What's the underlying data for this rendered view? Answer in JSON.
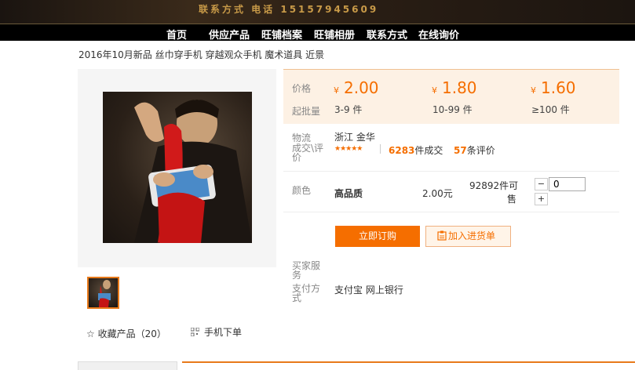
{
  "banner": {
    "contact": "联系方式 电话 15157945609"
  },
  "nav": [
    "首页",
    "供应产品",
    "旺铺档案",
    "旺铺相册",
    "联系方式",
    "在线询价"
  ],
  "product": {
    "title": "2016年10月新品 丝巾穿手机 穿越观众手机 魔术道具 近景",
    "favorite": "☆ 收藏产品（20）",
    "mobile_order": "手机下单"
  },
  "pricing": {
    "price_label": "价格",
    "moq_label": "起批量",
    "currency": "¥",
    "tiers": [
      {
        "price": "2.00",
        "qty": "3-9 件"
      },
      {
        "price": "1.80",
        "qty": "10-99 件"
      },
      {
        "price": "1.60",
        "qty": "≥100 件"
      }
    ]
  },
  "logistics": {
    "label": "物流",
    "origin": "浙江 金华"
  },
  "deals": {
    "label_line1": "成交\\评",
    "label_line2": "价",
    "stars": "★★★★★",
    "count": "6283",
    "count_unit": "件成交",
    "reviews": "57",
    "reviews_unit": "条评价"
  },
  "variant": {
    "label": "颜色",
    "name": "高品质",
    "price": "2.00元",
    "stock_line1": "92892件可",
    "stock_line2": "售",
    "qty_value": "0",
    "minus": "−",
    "plus": "+"
  },
  "actions": {
    "buy": "立即订购",
    "cart": "加入进货单"
  },
  "service": {
    "label_line1": "买家服",
    "label_line2": "务",
    "pay_label_line1": "支付方",
    "pay_label_line2": "式",
    "pay_methods": "支付宝 网上银行"
  },
  "colors": {
    "accent": "#f56e00",
    "banner_text": "#c89a48",
    "price_bg": "#fdf1e4"
  }
}
